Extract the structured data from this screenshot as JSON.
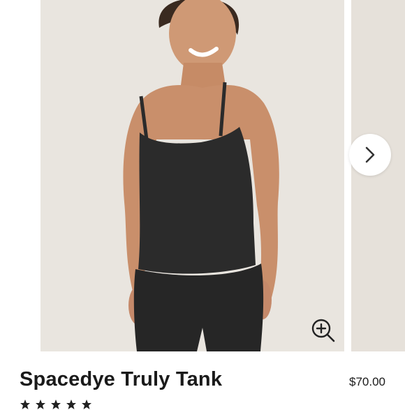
{
  "product": {
    "title": "Spacedye Truly Tank",
    "price": "$70.00",
    "rating": {
      "stars_shown": 5
    }
  },
  "gallery": {
    "next_icon": "chevron-right-icon",
    "zoom_icon": "zoom-in-icon"
  },
  "colors": {
    "background": "#ffffff",
    "photo_backdrop": "#e9e5df",
    "garment": "#2b2b2b",
    "skin": "#c98f6b",
    "text": "#1a1a1a"
  }
}
